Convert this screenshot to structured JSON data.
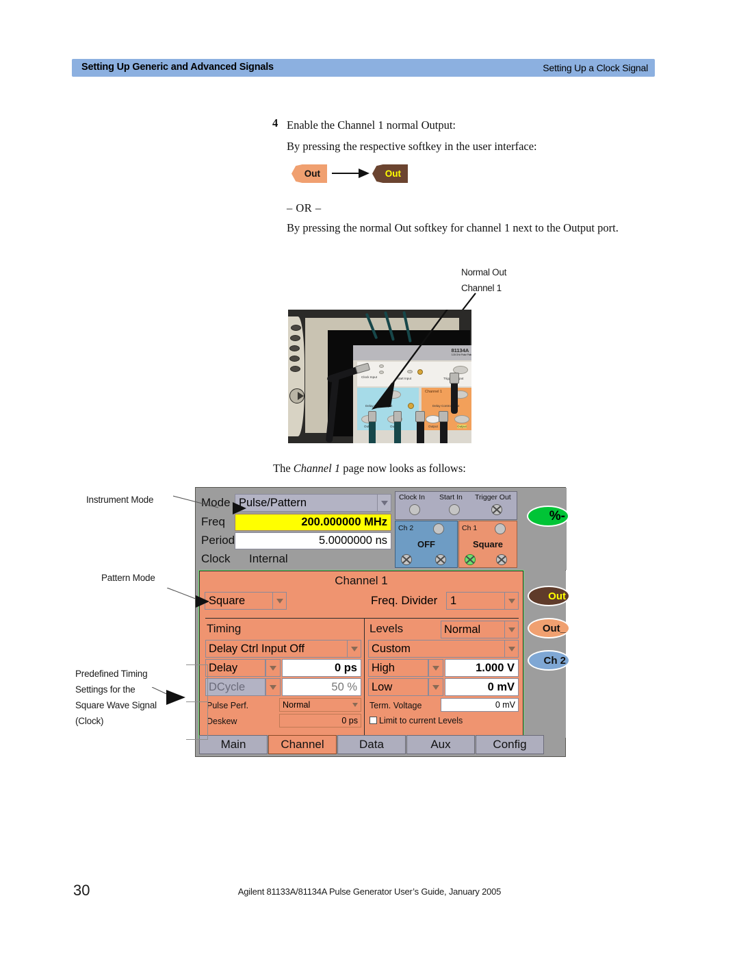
{
  "header": {
    "left_title": "Setting Up Generic and Advanced Signals",
    "right_title": "Setting Up a Clock Signal",
    "band_color": "#8cb0e0"
  },
  "body": {
    "step_number": "4",
    "step_text": "Enable the Channel 1 normal Output:",
    "line_softkey": "By pressing the respective softkey in the user interface:",
    "or_separator": "– OR –",
    "line_outport": "By pressing the normal Out softkey for channel 1 next to the Output port.",
    "caption_before": "The ",
    "caption_italic": "Channel 1",
    "caption_after": " page now looks as follows:"
  },
  "softkey_demo": {
    "inactive_label": "Out",
    "active_label": "Out",
    "inactive_color": "#f0a070",
    "active_color": "#6b4430",
    "active_text_color": "#ffff00"
  },
  "photo": {
    "model": "81134A",
    "model_sub": "3.35 GHz Pulse Pattern Generator",
    "labels": {
      "clock_in": "Clock Input",
      "start_in": "Start Input",
      "trigger_out": "Trigger Output",
      "delay_ctrl_in": "Delay Control Input",
      "channel1": "Channel 1",
      "output": "Output",
      "output_n": "Output"
    },
    "callout": {
      "line1": "Normal Out",
      "line2": "Channel 1"
    }
  },
  "ui": {
    "top": {
      "mode_label": "Mode",
      "mode_value": "Pulse/Pattern",
      "freq_label": "Freq",
      "freq_value": "200.000000 MHz",
      "period_label": "Period",
      "period_value": "5.0000000 ns",
      "clock_label": "Clock",
      "clock_value": "Internal"
    },
    "connector_map": {
      "clock_in": "Clock In",
      "start_in": "Start In",
      "trigger_out": "Trigger Out",
      "ch2_label": "Ch 2",
      "ch2_state": "OFF",
      "ch1_label": "Ch 1",
      "ch1_state": "Square"
    },
    "percent_key": "%-",
    "channel": {
      "title": "Channel 1",
      "shape_value": "Square",
      "divider_label": "Freq. Divider",
      "divider_value": "1"
    },
    "timing": {
      "section_title": "Timing",
      "delay_ctrl_value": "Delay Ctrl Input Off",
      "delay_label": "Delay",
      "delay_value": "0 ps",
      "dcycle_label": "DCycle",
      "dcycle_value": "50 %",
      "pulse_perf_label": "Pulse Perf.",
      "pulse_perf_value": "Normal",
      "deskew_label": "Deskew",
      "deskew_value": "0 ps"
    },
    "levels": {
      "section_title": "Levels",
      "mode_value": "Normal",
      "preset_value": "Custom",
      "high_label": "High",
      "high_value": "1.000 V",
      "low_label": "Low",
      "low_value": "0 mV",
      "term_label": "Term. Voltage",
      "term_value": "0 mV",
      "limit_label": "Limit to current Levels"
    },
    "right_keys": {
      "out": "Out",
      "out_inverted": "Out_",
      "ch2": "Ch 2"
    },
    "tabs": [
      {
        "label": "Main",
        "active": false
      },
      {
        "label": "Channel",
        "active": true
      },
      {
        "label": "Data",
        "active": false
      },
      {
        "label": "Aux",
        "active": false
      },
      {
        "label": "Config",
        "active": false
      }
    ],
    "colors": {
      "panel_grey": "#9d9d9d",
      "channel_orange": "#ef9470",
      "ch2_blue": "#6e9cc4",
      "freq_yellow": "#ffff00",
      "active_green": "#6fe06f",
      "percent_key_green": "#00c436"
    }
  },
  "annotations": {
    "instrument_mode": "Instrument Mode",
    "pattern_mode": "Pattern Mode",
    "predefined": [
      "Predefined Timing",
      "Settings for the",
      "Square Wave Signal",
      "(Clock)"
    ]
  },
  "footer": {
    "page_number": "30",
    "text": "Agilent 81133A/81134A Pulse Generator User’s Guide, January 2005"
  }
}
